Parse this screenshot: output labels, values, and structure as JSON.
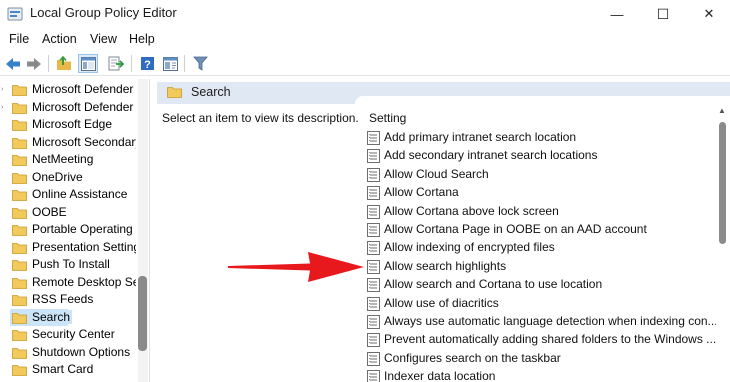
{
  "window": {
    "title": "Local Group Policy Editor",
    "minimize_glyph": "—",
    "maximize_glyph": "☐",
    "close_glyph": "✕"
  },
  "menu": [
    "File",
    "Action",
    "View",
    "Help"
  ],
  "toolbar": {
    "icons": [
      "back-icon",
      "forward-icon",
      "up-folder-icon",
      "show-hide-tree-icon",
      "export-list-icon",
      "help-icon",
      "properties-icon",
      "filter-icon"
    ],
    "selected": "show-hide-tree-icon"
  },
  "tree": {
    "items": [
      "Microsoft Defender",
      "Microsoft Defender",
      "Microsoft Edge",
      "Microsoft Secondary",
      "NetMeeting",
      "OneDrive",
      "Online Assistance",
      "OOBE",
      "Portable Operating",
      "Presentation Setting",
      "Push To Install",
      "Remote Desktop Ser",
      "RSS Feeds",
      "Search",
      "Security Center",
      "Shutdown Options",
      "Smart Card"
    ],
    "selected_index": 13
  },
  "panel": {
    "folder_title": "Search",
    "description_prompt": "Select an item to view its description.",
    "column_header": "Setting",
    "settings": [
      "Add primary intranet search location",
      "Add secondary intranet search locations",
      "Allow Cloud Search",
      "Allow Cortana",
      "Allow Cortana above lock screen",
      "Allow Cortana Page in OOBE on an AAD account",
      "Allow indexing of encrypted files",
      "Allow search highlights",
      "Allow search and Cortana to use location",
      "Allow use of diacritics",
      "Always use automatic language detection when indexing con...",
      "Prevent automatically adding shared folders to the Windows ...",
      "Configures search on the taskbar",
      "Indexer data location"
    ],
    "highlighted_setting": "Allow search highlights"
  },
  "colors": {
    "accent_selection": "#cce4f7",
    "header_band": "#dfe8f3",
    "annotation_arrow": "#e8191d",
    "folder": "#f2c95b"
  }
}
